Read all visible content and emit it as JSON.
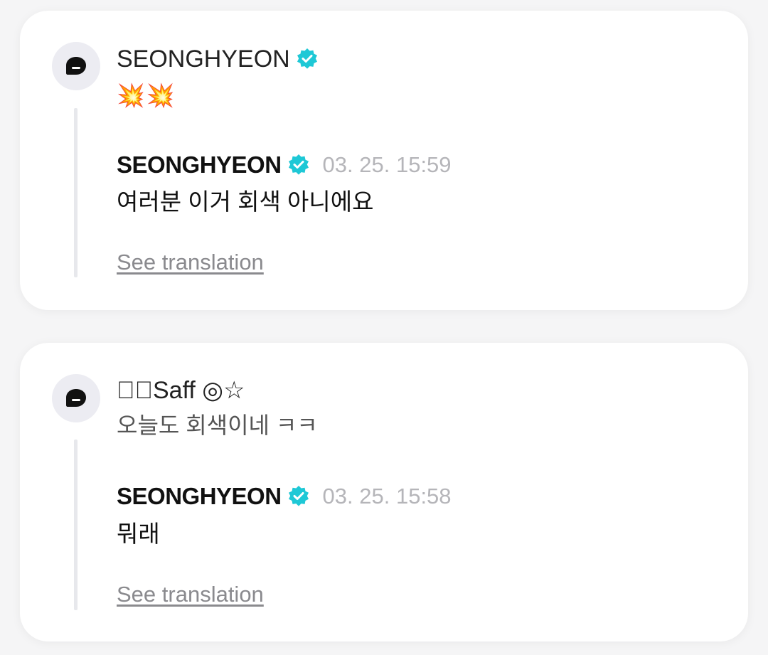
{
  "posts": [
    {
      "author": "SEONGHYEON",
      "author_verified": true,
      "text": "💥💥",
      "reply": {
        "author": "SEONGHYEON",
        "verified": true,
        "timestamp": "03. 25. 15:59",
        "text": "여러분 이거 회색 아니에요",
        "translate_label": "See translation"
      }
    },
    {
      "author": "☆゚Saff ◎☆",
      "author_verified": false,
      "text": "오늘도 회색이네 ㅋㅋ",
      "reply": {
        "author": "SEONGHYEON",
        "verified": true,
        "timestamp": "03. 25. 15:58",
        "text": "뭐래",
        "translate_label": "See translation"
      }
    }
  ],
  "colors": {
    "verified_badge": "#1ec8d6",
    "card_background": "#ffffff",
    "page_background": "#f5f5f6",
    "avatar_background": "#ececf2",
    "thread_line": "#e7e8ec",
    "timestamp": "#b5b5b9",
    "link": "#8a8a8e"
  },
  "icons": {
    "avatar": "speech-bubble-avatar-icon",
    "badge": "verified-badge-icon"
  }
}
